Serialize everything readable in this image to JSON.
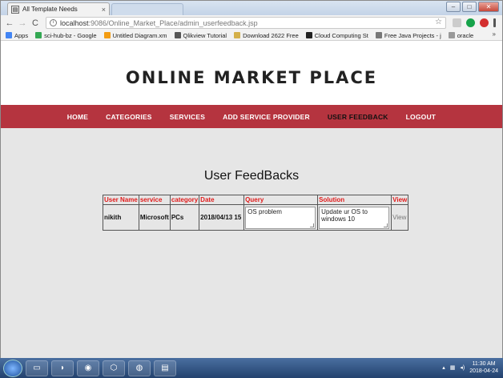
{
  "browser": {
    "tab_title": "All Template Needs",
    "tab_close": "×",
    "window_buttons": [
      "–",
      "□",
      "✕"
    ],
    "url_host": "localhost",
    "url_rest": ":9086/Online_Market_Place/admin_userfeedback.jsp",
    "nav": {
      "back": "←",
      "forward": "→",
      "reload": "C"
    },
    "bookmarks": [
      {
        "label": "Apps",
        "color": "#4285f4"
      },
      {
        "label": "sci-hub-bz - Google",
        "color": "#34a853"
      },
      {
        "label": "Untitled Diagram.xm",
        "color": "#f39c12"
      },
      {
        "label": "Qlikview Tutorial",
        "color": "#555555"
      },
      {
        "label": "Download 2622 Free",
        "color": "#d4b04a"
      },
      {
        "label": "Cloud Computing St",
        "color": "#222222"
      },
      {
        "label": "Free Java Projects - j",
        "color": "#777777"
      },
      {
        "label": "oracle",
        "color": "#999999"
      }
    ],
    "bookmarks_more": "»"
  },
  "site": {
    "title": "ONLINE MARKET PLACE",
    "nav": [
      {
        "label": "HOME",
        "active": false
      },
      {
        "label": "CATEGORIES",
        "active": false
      },
      {
        "label": "SERVICES",
        "active": false
      },
      {
        "label": "ADD SERVICE PROVIDER",
        "active": false
      },
      {
        "label": "USER FEEDBACK",
        "active": true
      },
      {
        "label": "LOGOUT",
        "active": false
      }
    ],
    "accent": "#b5343f"
  },
  "feedback": {
    "title": "User FeedBacks",
    "columns": [
      "User Name",
      "service",
      "category",
      "Date",
      "Query",
      "Solution",
      "View"
    ],
    "rows": [
      {
        "user": "nikith",
        "service": "Microsoft",
        "category": "PCs",
        "date": "2018/04/13 15",
        "query": "OS problem",
        "solution": "Update ur OS to windows 10",
        "view": "View"
      }
    ]
  },
  "taskbar": {
    "time": "11:30 AM",
    "date": "2018-04-24"
  }
}
